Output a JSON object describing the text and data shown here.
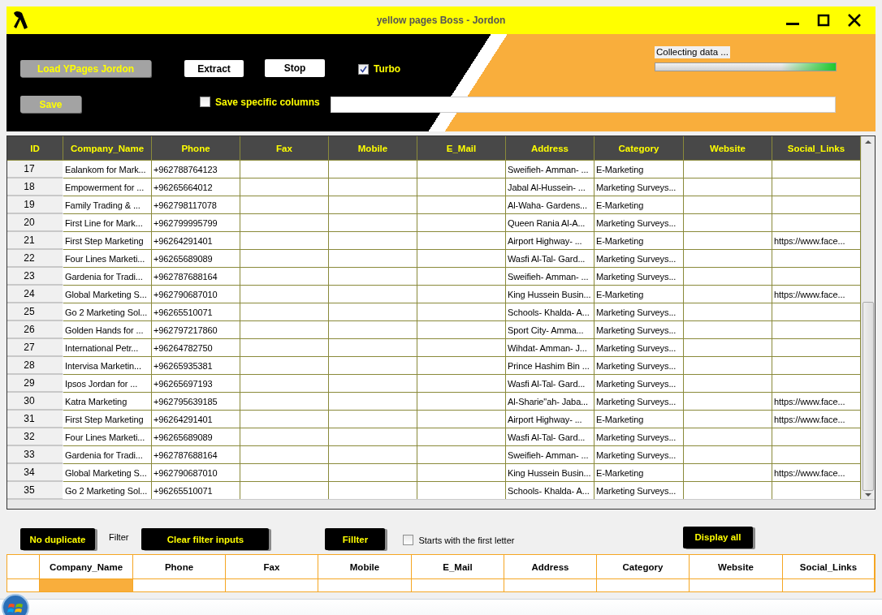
{
  "window": {
    "title": "yellow pages Boss - Jordon"
  },
  "controls": {
    "load_button": {
      "label": "Load YPages Jordon",
      "disabled": true
    },
    "extract_button": {
      "label": "Extract",
      "disabled": false
    },
    "stop_button": {
      "label": "Stop",
      "disabled": false
    },
    "turbo": {
      "label": "Turbo",
      "checked": true
    },
    "save_button": {
      "label": "Save",
      "disabled": true
    },
    "save_columns": {
      "label": "Save specific columns",
      "checked": false
    }
  },
  "progress": {
    "status": "Collecting data ...",
    "level": 0.3
  },
  "table": {
    "columns": [
      "ID",
      "Company_Name",
      "Phone",
      "Fax",
      "Mobile",
      "E_Mail",
      "Address",
      "Category",
      "Website",
      "Social_Links"
    ],
    "rows": [
      {
        "id": "17",
        "company_name": "Ealankom for Mark...",
        "phone": "+962788764123",
        "address": "Sweifieh- Amman- ...",
        "category": "E-Marketing"
      },
      {
        "id": "18",
        "company_name": "Empowerment for ...",
        "phone": "+96265664012",
        "address": "Jabal Al-Hussein- ...",
        "category": "Marketing Surveys..."
      },
      {
        "id": "19",
        "company_name": "Family Trading & ...",
        "phone": "+962798117078",
        "address": "Al-Waha- Gardens...",
        "category": "E-Marketing"
      },
      {
        "id": "20",
        "company_name": "First Line for Mark...",
        "phone": "+962799995799",
        "address": "Queen Rania Al-A...",
        "category": "Marketing Surveys..."
      },
      {
        "id": "21",
        "company_name": "First Step Marketing",
        "phone": "+96264291401",
        "address": "Airport Highway- ...",
        "category": "E-Marketing",
        "social_links": "https://www.face..."
      },
      {
        "id": "22",
        "company_name": "Four Lines Marketi...",
        "phone": "+96265689089",
        "address": "Wasfi Al-Tal- Gard...",
        "category": "Marketing Surveys..."
      },
      {
        "id": "23",
        "company_name": "Gardenia for Tradi...",
        "phone": "+962787688164",
        "address": "Sweifieh- Amman- ...",
        "category": "Marketing Surveys..."
      },
      {
        "id": "24",
        "company_name": "Global Marketing S...",
        "phone": "+962790687010",
        "address": "King Hussein Busin...",
        "category": "E-Marketing",
        "social_links": "https://www.face..."
      },
      {
        "id": "25",
        "company_name": "Go 2 Marketing Sol...",
        "phone": "+96265510071",
        "address": "Schools- Khalda- A...",
        "category": "Marketing Surveys..."
      },
      {
        "id": "26",
        "company_name": "Golden Hands for ...",
        "phone": "+962797217860",
        "address": "Sport City- Amma...",
        "category": "Marketing Surveys..."
      },
      {
        "id": "27",
        "company_name": "International Petr...",
        "phone": "+96264782750",
        "address": "Wihdat- Amman- J...",
        "category": "Marketing Surveys..."
      },
      {
        "id": "28",
        "company_name": "Intervisa Marketin...",
        "phone": "+96265935381",
        "address": "Prince Hashim Bin ...",
        "category": "Marketing Surveys..."
      },
      {
        "id": "29",
        "company_name": "Ipsos Jordan for ...",
        "phone": "+96265697193",
        "address": "Wasfi Al-Tal- Gard...",
        "category": "Marketing Surveys..."
      },
      {
        "id": "30",
        "company_name": "Katra Marketing",
        "phone": "+962795639185",
        "address": "Al-Sharie\"ah- Jaba...",
        "category": "Marketing Surveys...",
        "social_links": "https://www.face..."
      },
      {
        "id": "31",
        "company_name": "First Step Marketing",
        "phone": "+96264291401",
        "address": "Airport Highway- ...",
        "category": "E-Marketing",
        "social_links": "https://www.face..."
      },
      {
        "id": "32",
        "company_name": "Four Lines Marketi...",
        "phone": "+96265689089",
        "address": "Wasfi Al-Tal- Gard...",
        "category": "Marketing Surveys..."
      },
      {
        "id": "33",
        "company_name": "Gardenia for Tradi...",
        "phone": "+962787688164",
        "address": "Sweifieh- Amman- ...",
        "category": "Marketing Surveys..."
      },
      {
        "id": "34",
        "company_name": "Global Marketing S...",
        "phone": "+962790687010",
        "address": "King Hussein Busin...",
        "category": "E-Marketing",
        "social_links": "https://www.face..."
      },
      {
        "id": "35",
        "company_name": "Go 2 Marketing Sol...",
        "phone": "+96265510071",
        "address": "Schools- Khalda- A...",
        "category": "Marketing Surveys..."
      }
    ]
  },
  "filter_bar": {
    "no_duplicate_button": "No duplicate",
    "filter_label": "Filter",
    "clear_button": "Clear filter inputs",
    "filter_button": "Fillter",
    "starts_with": {
      "label": "Starts with the first letter",
      "checked": false
    },
    "display_all_button": "Display all"
  },
  "filter_table": {
    "columns": [
      "Company_Name",
      "Phone",
      "Fax",
      "Mobile",
      "E_Mail",
      "Address",
      "Category",
      "Website",
      "Social_Links"
    ],
    "rows": [
      {
        "current": true
      }
    ]
  }
}
